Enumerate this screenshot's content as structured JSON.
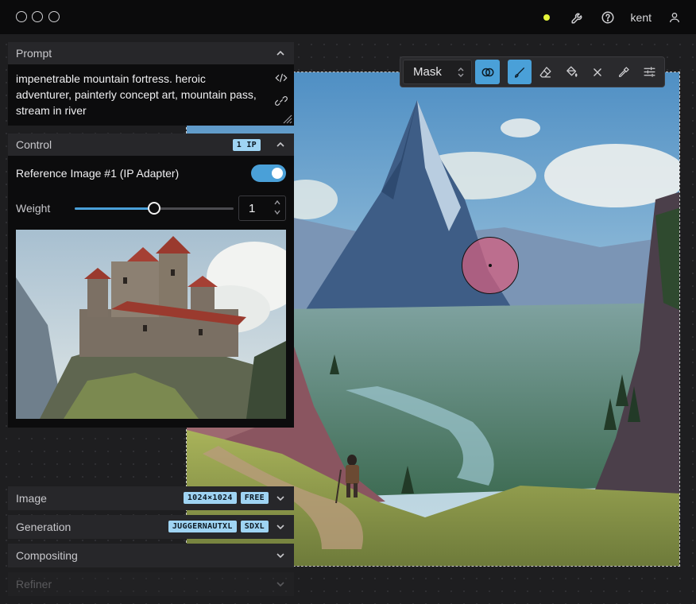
{
  "titlebar": {
    "status_color": "#e5f53a",
    "username": "kent",
    "icons": [
      "wrench-icon",
      "help-icon",
      "user-icon"
    ]
  },
  "toolbar": {
    "mode_select": "Mask",
    "tools": [
      "brush-link-icon",
      "brush-icon",
      "eraser-icon",
      "fill-icon",
      "clear-icon",
      "eyedropper-icon",
      "settings-sliders-icon"
    ],
    "active_tool": "brush-icon",
    "accent_color": "#4aa0d8"
  },
  "prompt_panel": {
    "title": "Prompt",
    "text": "impenetrable mountain fortress. heroic adventurer, painterly concept art, mountain pass, stream in river"
  },
  "control_panel": {
    "title": "Control",
    "badge": "1 IP",
    "reference_label": "Reference Image #1 (IP Adapter)",
    "enabled": true,
    "weight_label": "Weight",
    "weight_value": "1",
    "weight_fraction": 0.5
  },
  "sections": {
    "image": {
      "title": "Image",
      "badges": [
        "1024×1024",
        "FREE"
      ]
    },
    "generation": {
      "title": "Generation",
      "badges": [
        "JUGGERNAUTXL",
        "SDXL"
      ]
    },
    "compositing": {
      "title": "Compositing"
    },
    "refiner": {
      "title": "Refiner"
    }
  }
}
